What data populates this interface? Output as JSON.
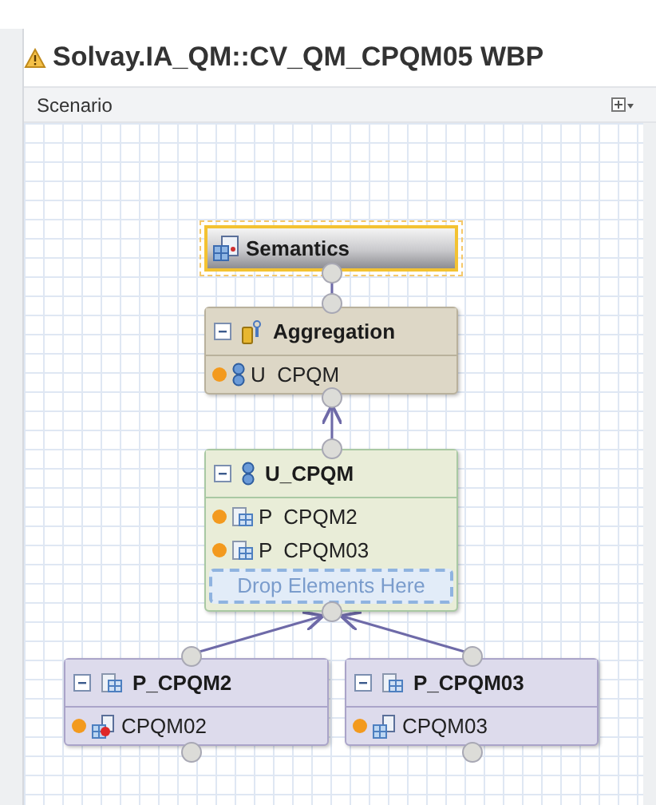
{
  "window": {
    "title": "Solvay.IA_QM::CV_QM_CPQM05 WBP"
  },
  "panel": {
    "title": "Scenario"
  },
  "nodes": [
    {
      "kind": "semantics",
      "title": "Semantics",
      "selected": true
    },
    {
      "kind": "aggregation",
      "title": "Aggregation",
      "selected": false,
      "rows": [
        {
          "label": "U  CPQM",
          "error": false
        }
      ]
    },
    {
      "kind": "union",
      "title": "U_CPQM",
      "selected": false,
      "rows": [
        {
          "label": "P  CPQM2",
          "error": false
        },
        {
          "label": "P  CPQM03",
          "error": false
        }
      ],
      "drop_zone": "Drop Elements Here"
    },
    {
      "kind": "projection",
      "title": "P_CPQM2",
      "selected": false,
      "rows": [
        {
          "label": "CPQM02",
          "error": true
        }
      ]
    },
    {
      "kind": "projection",
      "title": "P_CPQM03",
      "selected": false,
      "rows": [
        {
          "label": "CPQM03",
          "error": false
        }
      ]
    }
  ]
}
